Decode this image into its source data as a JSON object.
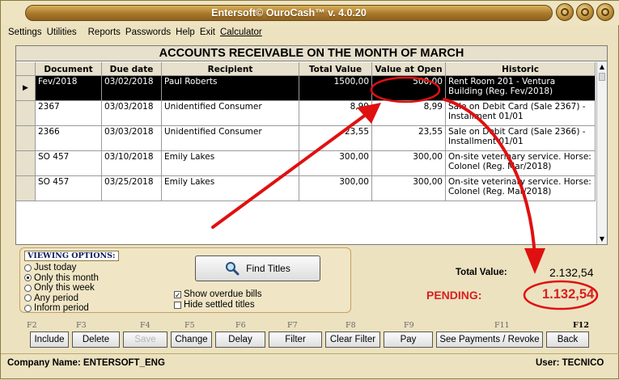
{
  "window": {
    "title": "Entersoft© OuroCash™ v. 4.0.20"
  },
  "menu": {
    "items": [
      "Settings",
      "Utilities",
      "Reports",
      "Passwords",
      "Help",
      "Exit",
      "Calculator"
    ]
  },
  "sheet": {
    "title": "ACCOUNTS RECEIVABLE ON THE MONTH OF MARCH",
    "columns": [
      "Document",
      "Due date",
      "Recipient",
      "Total Value",
      "Value at Open",
      "Historic"
    ],
    "rows": [
      {
        "document": "Fev/2018",
        "due": "03/02/2018",
        "recipient": "Paul Roberts",
        "total": "1500,00",
        "open": "500,00",
        "historic": "Rent Room 201 - Ventura Building (Reg. Fev/2018)"
      },
      {
        "document": "2367",
        "due": "03/03/2018",
        "recipient": "Unidentified Consumer",
        "total": "8,99",
        "open": "8,99",
        "historic": "Sale on Debit Card (Sale 2367) - Installment 01/01"
      },
      {
        "document": "2366",
        "due": "03/03/2018",
        "recipient": "Unidentified Consumer",
        "total": "23,55",
        "open": "23,55",
        "historic": "Sale on Debit Card (Sale 2366) - Installment 01/01"
      },
      {
        "document": "SO 457",
        "due": "03/10/2018",
        "recipient": "Emily Lakes",
        "total": "300,00",
        "open": "300,00",
        "historic": "On-site veterinary service. Horse: Colonel (Reg. Mar/2018)"
      },
      {
        "document": "SO 457",
        "due": "03/25/2018",
        "recipient": "Emily Lakes",
        "total": "300,00",
        "open": "300,00",
        "historic": "On-site veterinary service. Horse: Colonel (Reg. Mar/2018)"
      }
    ]
  },
  "viewing": {
    "title": "VIEWING OPTIONS:",
    "options": [
      "Just today",
      "Only this month",
      "Only this week",
      "Any period",
      "Inform period"
    ],
    "selected": "Only this month",
    "find_label": "Find Titles",
    "show_overdue": "Show overdue bills",
    "hide_settled": "Hide settled titles"
  },
  "totals": {
    "total_label": "Total Value:",
    "total_value": "2.132,54",
    "pending_label": "PENDING:",
    "pending_value": "1.132,54"
  },
  "fkeys": [
    "F2",
    "F3",
    "F4",
    "F5",
    "F6",
    "F7",
    "F8",
    "F9",
    "F11",
    "F12"
  ],
  "buttons": [
    "Include",
    "Delete",
    "Save",
    "Change",
    "Delay",
    "Filter",
    "Clear Filter",
    "Pay",
    "See Payments / Revoke",
    "Back"
  ],
  "status": {
    "company": "Company Name: ENTERSOFT_ENG",
    "user": "User: TECNICO"
  },
  "colors": {
    "annotation": "#e01010",
    "title_gold": "#a9782a"
  }
}
